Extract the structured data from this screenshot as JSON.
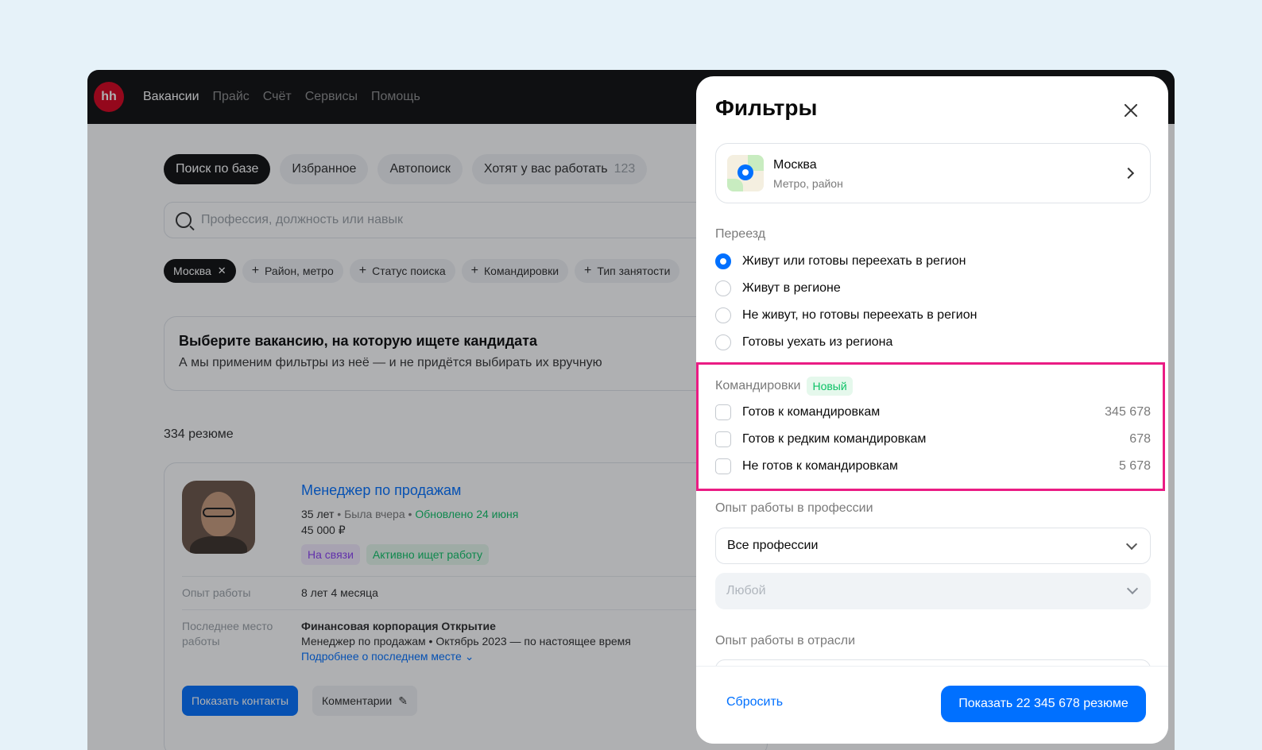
{
  "topbar": {
    "logo": "hh",
    "nav": [
      "Вакансии",
      "Прайс",
      "Счёт",
      "Сервисы",
      "Помощь"
    ]
  },
  "tabs": {
    "search_base": "Поиск по базе",
    "favorites": "Избранное",
    "autosearch": "Автопоиск",
    "want_work": "Хотят у вас работать",
    "want_work_count": "123"
  },
  "search": {
    "placeholder": "Профессия, должность или навык"
  },
  "chips": {
    "city": "Москва",
    "district": "Район, метро",
    "status": "Статус поиска",
    "trips": "Командировки",
    "employment": "Тип занятости"
  },
  "vacancy_prompt": {
    "title": "Выберите вакансию, на которую ищете кандидата",
    "subtitle": "А мы применим фильтры из неё — и не придётся выбирать их вручную"
  },
  "results_count": "334 резюме",
  "resume": {
    "title": "Менеджер по продажам",
    "age": "35 лет",
    "last_seen": "Была вчера",
    "updated": "Обновлено 24 июня",
    "salary": "45 000 ₽",
    "tag_contact": "На связи",
    "tag_active": "Активно ищет работу",
    "exp_label": "Опыт работы",
    "exp_value": "8 лет 4 месяца",
    "last_place_label_1": "Последнее место",
    "last_place_label_2": "работы",
    "company": "Финансовая корпорация Открытие",
    "position": "Менеджер по продажам",
    "period": "Октябрь 2023 — по настоящее время",
    "more_link": "Подробнее о последнем месте",
    "btn_contacts": "Показать контакты",
    "btn_comments": "Комментарии"
  },
  "filters": {
    "title": "Фильтры",
    "city_name": "Москва",
    "city_sub": "Метро, район",
    "relocation_label": "Переезд",
    "relocation_options": [
      "Живут или готовы переехать в регион",
      "Живут в регионе",
      "Не живут, но готовы переехать в регион",
      "Готовы уехать из региона"
    ],
    "relocation_selected": 0,
    "trips_label": "Командировки",
    "trips_badge": "Новый",
    "trips_options": [
      {
        "label": "Готов к командировкам",
        "count": "345 678"
      },
      {
        "label": "Готов к редким командировкам",
        "count": "678"
      },
      {
        "label": "Не готов к командировкам",
        "count": "5 678"
      }
    ],
    "prof_exp_label": "Опыт работы в профессии",
    "prof_select": "Все профессии",
    "prof_any": "Любой",
    "industry_exp_label": "Опыт работы в отрасли",
    "reset": "Сбросить",
    "show": "Показать 22 345 678 резюме"
  },
  "colors": {
    "accent": "#0070ff",
    "highlight": "#ea1c84",
    "green": "#0dc267",
    "brand": "#d6001c"
  }
}
